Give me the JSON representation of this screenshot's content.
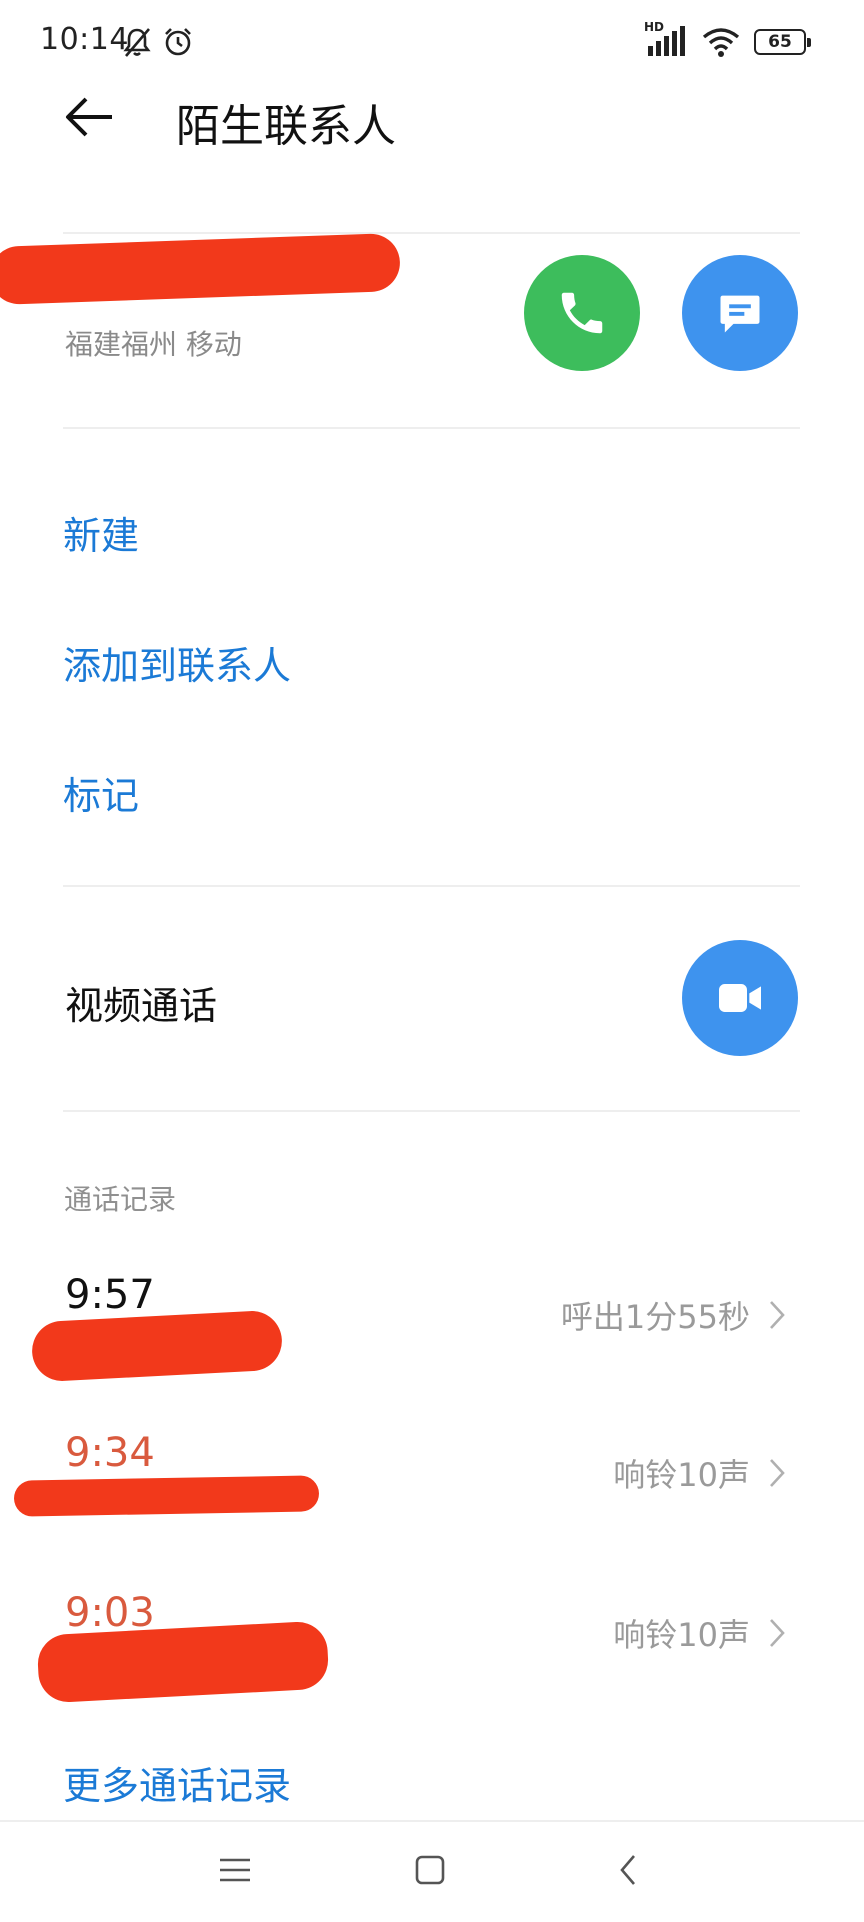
{
  "status_bar": {
    "time": "10:14",
    "network": "HD",
    "battery": "65"
  },
  "header": {
    "title": "陌生联系人"
  },
  "caller": {
    "location": "福建福州 移动"
  },
  "actions": {
    "new": "新建",
    "add_to_contacts": "添加到联系人",
    "mark": "标记"
  },
  "video_call": {
    "label": "视频通话"
  },
  "call_log": {
    "section_title": "通话记录",
    "entries": [
      {
        "time": "9:57",
        "detail": "呼出1分55秒",
        "type": "outgoing"
      },
      {
        "time": "9:34",
        "detail": "响铃10声",
        "type": "missed"
      },
      {
        "time": "9:03",
        "detail": "响铃10声",
        "type": "missed"
      }
    ],
    "more": "更多通话记录"
  },
  "colors": {
    "accent_blue": "#1b7ad6",
    "call_green": "#3dbd5c",
    "action_blue": "#3e93ee",
    "missed_red": "#d95a3e",
    "redaction": "#f2391b"
  }
}
